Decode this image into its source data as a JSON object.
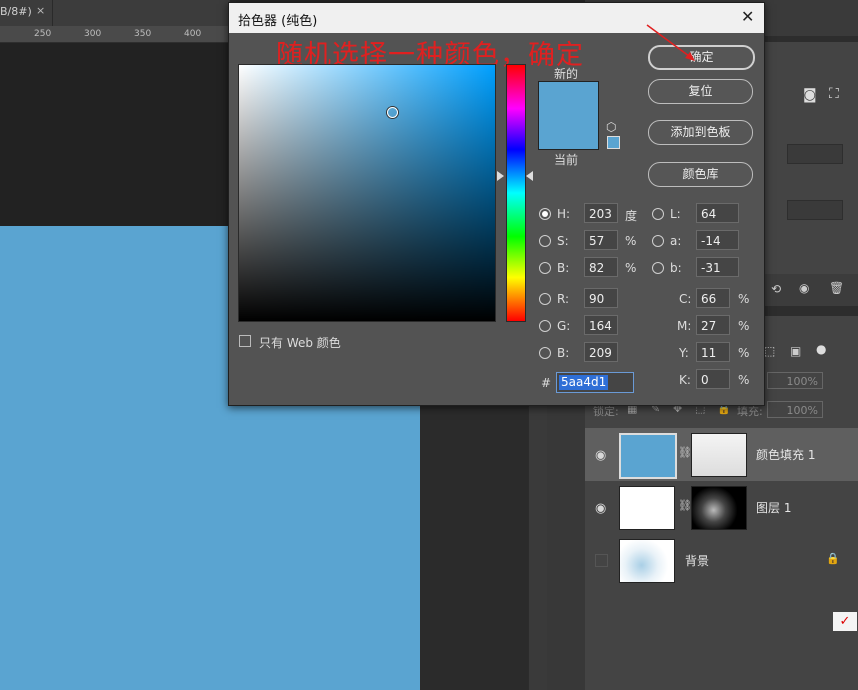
{
  "document_tab": {
    "label": "B/8#)",
    "close": "×"
  },
  "ruler": {
    "ticks": [
      "250",
      "300",
      "350",
      "400"
    ]
  },
  "canvas": {
    "fill_color": "#5aa4d1"
  },
  "layers": [
    {
      "name": "颜色填充 1",
      "visible": true
    },
    {
      "name": "图层 1",
      "visible": true
    },
    {
      "name": "背景",
      "visible": false,
      "locked": true
    }
  ],
  "panel_controls": {
    "opacity": "100%",
    "lock_label": "锁定:",
    "fill_label": "填充:",
    "fill": "100%"
  },
  "color_picker": {
    "title": "拾色器 (纯色)",
    "annotation": "随机选择一种颜色，确定",
    "new_label": "新的",
    "current_label": "当前",
    "buttons": {
      "ok": "确定",
      "reset": "复位",
      "add_to_swatches": "添加到色板",
      "color_libraries": "颜色库"
    },
    "web_only_label": "只有 Web 颜色",
    "selected_color": "#5aa4d1",
    "fields": {
      "H": {
        "label": "H:",
        "value": "203",
        "unit": "度"
      },
      "S": {
        "label": "S:",
        "value": "57",
        "unit": "%"
      },
      "B": {
        "label": "B:",
        "value": "82",
        "unit": "%"
      },
      "R": {
        "label": "R:",
        "value": "90"
      },
      "G": {
        "label": "G:",
        "value": "164"
      },
      "Bl": {
        "label": "B:",
        "value": "209"
      },
      "L": {
        "label": "L:",
        "value": "64"
      },
      "a": {
        "label": "a:",
        "value": "-14"
      },
      "b": {
        "label": "b:",
        "value": "-31"
      },
      "C": {
        "label": "C:",
        "value": "66",
        "unit": "%"
      },
      "M": {
        "label": "M:",
        "value": "27",
        "unit": "%"
      },
      "Y": {
        "label": "Y:",
        "value": "11",
        "unit": "%"
      },
      "K": {
        "label": "K:",
        "value": "0",
        "unit": "%"
      }
    },
    "hex": {
      "label": "#",
      "value": "5aa4d1"
    }
  }
}
